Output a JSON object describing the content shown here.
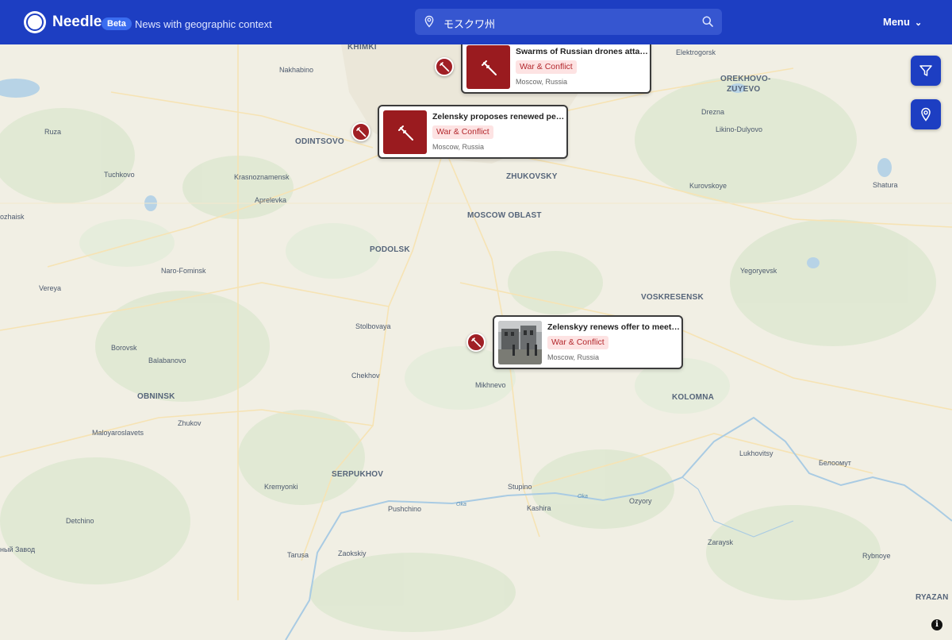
{
  "header": {
    "brand": "Needle",
    "badge": "Beta",
    "tagline": "News with geographic context",
    "menu_label": "Menu",
    "logo_icon": "compass-icon"
  },
  "search": {
    "value": "モスクワ州",
    "pin_icon": "location-pin-icon",
    "search_icon": "search-icon"
  },
  "controls": {
    "filter_icon": "filter-icon",
    "locate_icon": "location-pin-icon",
    "info_label": "i"
  },
  "map": {
    "places": {
      "khimki": "KHIMKI",
      "nakhabino": "Nakhabino",
      "elektrogorsk": "Elektrogorsk",
      "orekhovo1": "OREKHOVO-",
      "orekhovo2": "ZUYEVO",
      "drezna": "Drezna",
      "likino": "Likino-Dulyovo",
      "ruza": "Ruza",
      "odintsovo": "ODINTSOVO",
      "tuchkovo": "Tuchkovo",
      "krasnoznamensk": "Krasnoznamensk",
      "zhukovsky": "ZHUKOVSKY",
      "kurovskoye": "Kurovskoye",
      "shatura": "Shatura",
      "aprelevka": "Aprelevka",
      "mozhaisk": "ozhaisk",
      "moscow_oblast": "MOSCOW OBLAST",
      "podolsk": "PODOLSK",
      "naro_fominsk": "Naro-Fominsk",
      "yegoryevsk": "Yegoryevsk",
      "vereya": "Vereya",
      "voskresensk": "VOSKRESENSK",
      "stolbovaya": "Stolbovaya",
      "borovsk": "Borovsk",
      "balabanovo": "Balabanovo",
      "chekhov": "Chekhov",
      "mikhnevo": "Mikhnevo",
      "obninsk": "OBNINSK",
      "kolomna": "KOLOMNA",
      "zhukov": "Zhukov",
      "maloyaroslavets": "Maloyaroslavets",
      "lukhovitsy": "Lukhovitsy",
      "belоomut": "Белоомут",
      "serpukhov": "SERPUKHOV",
      "kremyonki": "Kremyonki",
      "stupino": "Stupino",
      "oka1": "Oka",
      "oka2": "Oka",
      "pushchino": "Pushchino",
      "kashira": "Kashira",
      "ozyory": "Ozyory",
      "detchino": "Detchino",
      "lesnoy": "ный Завод",
      "zaraysk": "Zaraysk",
      "tarusa": "Tarusa",
      "zaokskiy": "Zaokskiy",
      "rybnoye": "Rybnoye",
      "ryazan": "RYAZAN"
    }
  },
  "articles": [
    {
      "title": "Swarms of Russian drones atta…",
      "category": "War & Conflict",
      "location": "Moscow, Russia",
      "icon": "syringe-icon",
      "color": "#a01f25"
    },
    {
      "title": "Zelensky proposes renewed pe…",
      "category": "War & Conflict",
      "location": "Moscow, Russia",
      "icon": "syringe-icon",
      "color": "#a01f25"
    },
    {
      "title": "Zelenskyy renews offer to meet…",
      "category": "War & Conflict",
      "location": "Moscow, Russia",
      "icon": "photo-thumbnail",
      "color": "#a01f25"
    }
  ]
}
